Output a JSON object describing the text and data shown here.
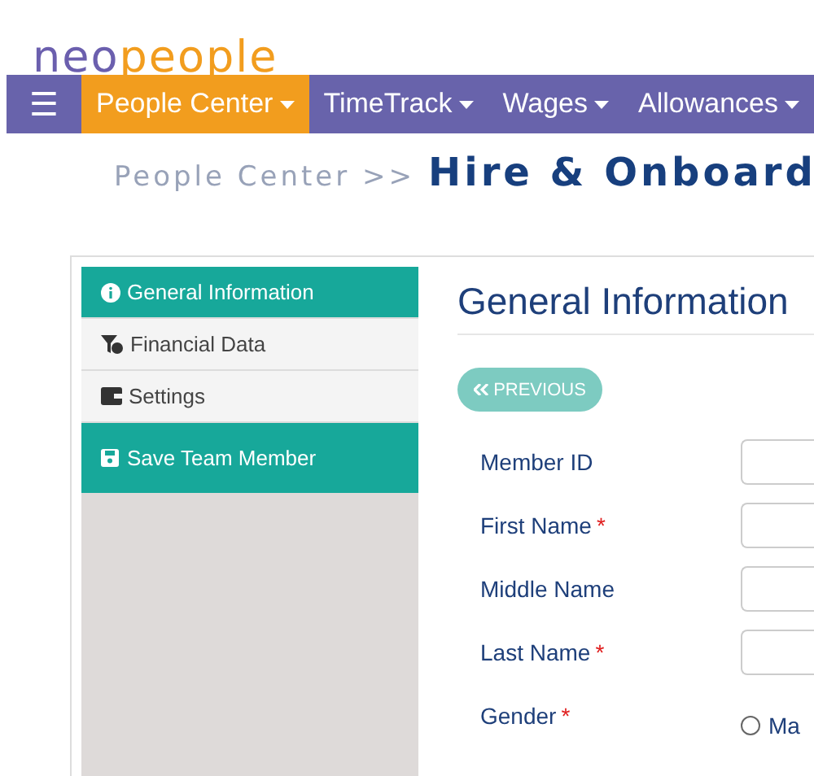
{
  "logo": {
    "parts": [
      {
        "text": "neo",
        "color": "#6b5fae"
      },
      {
        "text": "people",
        "color": "#f29d1e"
      }
    ]
  },
  "nav": {
    "menu_icon": "☰",
    "items": [
      {
        "label": "People Center",
        "selected": true
      },
      {
        "label": "TimeTrack",
        "selected": false
      },
      {
        "label": "Wages",
        "selected": false
      },
      {
        "label": "Allowances",
        "selected": false
      }
    ]
  },
  "breadcrumb": {
    "parent": "People Center >>",
    "current": "Hire & Onboard"
  },
  "sidebar": {
    "items": [
      {
        "kind": "info",
        "label": "General Information",
        "selected": true
      },
      {
        "kind": "finance",
        "label": "Financial Data",
        "selected": false
      },
      {
        "kind": "settings",
        "label": "Settings",
        "selected": false
      }
    ],
    "save_button": "Save Team Member"
  },
  "form": {
    "title": "General Information",
    "previous_button": "PREVIOUS",
    "required_mark": "*",
    "fields": [
      {
        "kind": "text",
        "label": "Member ID",
        "required": false
      },
      {
        "kind": "text",
        "label": "First Name",
        "required": true
      },
      {
        "kind": "text",
        "label": "Middle Name",
        "required": false
      },
      {
        "kind": "text",
        "label": "Last Name",
        "required": true
      },
      {
        "kind": "radio",
        "label": "Gender",
        "required": true,
        "options": [
          {
            "label": "Ma",
            "selected": false
          }
        ]
      }
    ]
  }
}
